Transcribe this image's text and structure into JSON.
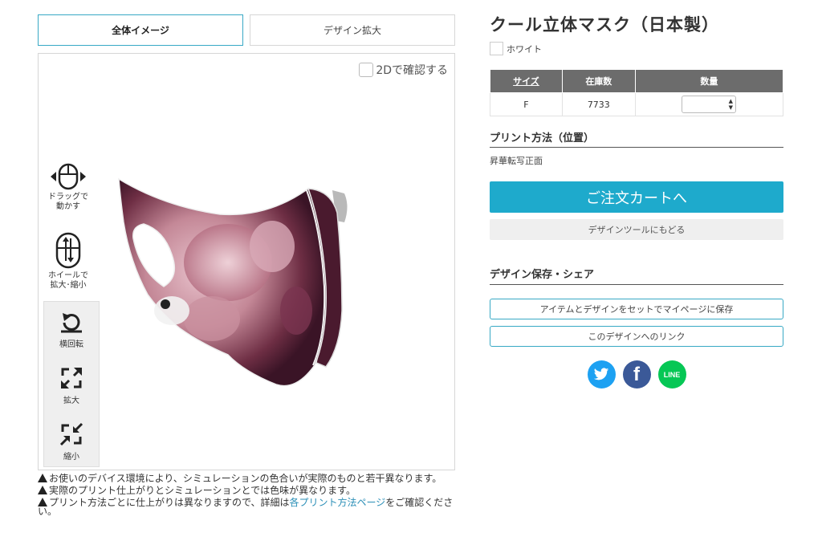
{
  "tabs": {
    "overall": "全体イメージ",
    "zoom": "デザイン拡大"
  },
  "viewer": {
    "check_2d": "2Dで確認する",
    "drag_label_1": "ドラッグで",
    "drag_label_2": "動かす",
    "wheel_label_1": "ホイールで",
    "wheel_label_2": "拡大･縮小",
    "rotate_label": "横回転",
    "enlarge_label": "拡大",
    "shrink_label": "縮小"
  },
  "notes": {
    "n1": "お使いのデバイス環境により、シミュレーションの色合いが実際のものと若干異なります。",
    "n2": "実際のプリント仕上がりとシミュレーションとでは色味が異なります。",
    "n3_pre": "プリント方法ごとに仕上がりは異なりますので、詳細は",
    "n3_link": "各プリント方法ページ",
    "n3_post": "をご確認ください。"
  },
  "product": {
    "title": "クール立体マスク（日本製）",
    "color": "ホワイト"
  },
  "stock_table": {
    "headers": [
      "サイズ",
      "在庫数",
      "数量"
    ],
    "rows": [
      {
        "size": "F",
        "stock": "7733",
        "qty": ""
      }
    ]
  },
  "print": {
    "heading": "プリント方法（位置）",
    "method": "昇華転写正面"
  },
  "buttons": {
    "cart": "ご注文カートへ",
    "back": "デザインツールにもどる"
  },
  "share": {
    "heading": "デザイン保存・シェア",
    "save": "アイテムとデザインをセットでマイページに保存",
    "link": "このデザインへのリンク"
  },
  "social": {
    "twitter": "twitter-icon",
    "facebook": "f",
    "line": "LINE"
  },
  "colors": {
    "accent": "#1eaacc",
    "header_gray": "#6c6c6c"
  }
}
